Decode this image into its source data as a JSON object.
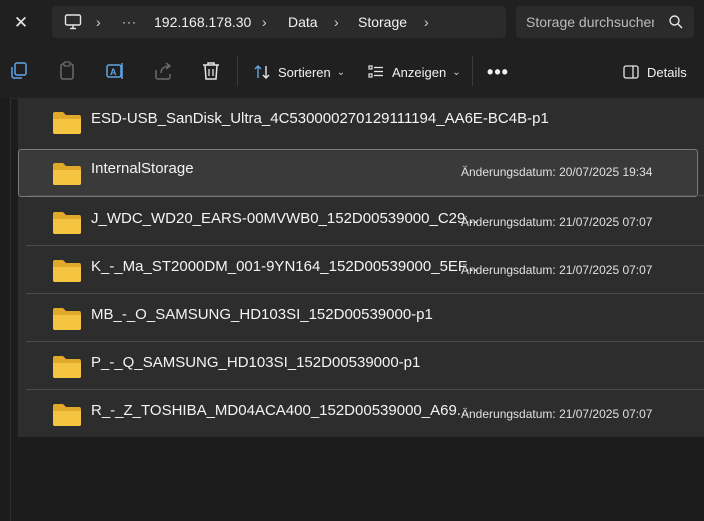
{
  "address_bar": {
    "ellipsis": "···",
    "crumbs": [
      "192.168.178.30",
      "Data",
      "Storage"
    ]
  },
  "search": {
    "placeholder": "Storage durchsuchen"
  },
  "toolbar": {
    "sort_label": "Sortieren",
    "view_label": "Anzeigen",
    "more_label": "•••",
    "details_label": "Details"
  },
  "files": {
    "rows": [
      {
        "name": "ESD-USB_SanDisk_Ultra_4C530000270129111194_AA6E-BC4B-p1",
        "date": ""
      },
      {
        "name": "InternalStorage",
        "date": "Änderungsdatum: 20/07/2025 19:34"
      },
      {
        "name": "J_WDC_WD20_EARS-00MVWB0_152D00539000_C29...",
        "date": "Änderungsdatum: 21/07/2025 07:07"
      },
      {
        "name": "K_-_Ma_ST2000DM_001-9YN164_152D00539000_5EF...",
        "date": "Änderungsdatum: 21/07/2025 07:07"
      },
      {
        "name": "MB_-_O_SAMSUNG_HD103SI_152D00539000-p1",
        "date": ""
      },
      {
        "name": "P_-_Q_SAMSUNG_HD103SI_152D00539000-p1",
        "date": ""
      },
      {
        "name": "R_-_Z_TOSHIBA_MD04ACA400_152D00539000_A69...",
        "date": "Änderungsdatum: 21/07/2025 07:07"
      }
    ]
  },
  "icons": {
    "close": "close-icon",
    "computer": "computer-icon",
    "folder": "folder-icon",
    "copy": "copy-icon",
    "paste": "paste-icon",
    "rename": "rename-icon",
    "share": "share-icon",
    "delete": "delete-icon",
    "sort": "sort-icon",
    "view": "view-icon",
    "details": "details-pane-icon",
    "search": "search-icon"
  },
  "colors": {
    "folder": "#f5c542",
    "background": "#1c1c1c",
    "list_bg": "#2d2d2d",
    "accent_blue": "#60a5e8"
  }
}
